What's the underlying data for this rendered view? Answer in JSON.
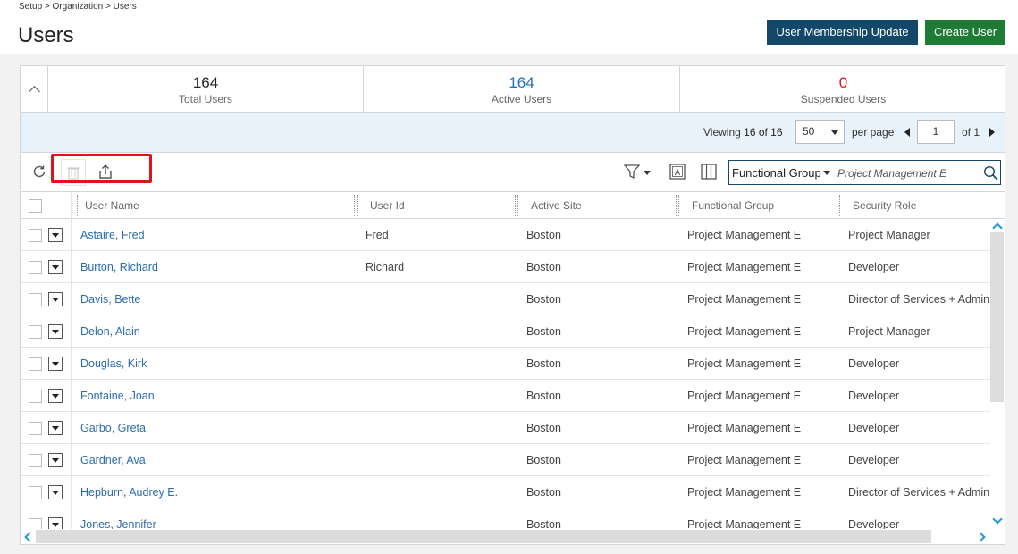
{
  "breadcrumb": "Setup > Organization > Users",
  "page_title": "Users",
  "buttons": {
    "membership_update": "User Membership Update",
    "create_user": "Create User"
  },
  "stats": [
    {
      "value": "164",
      "label": "Total Users",
      "color": "#222222"
    },
    {
      "value": "164",
      "label": "Active Users",
      "color": "#1f6fbf"
    },
    {
      "value": "0",
      "label": "Suspended Users",
      "color": "#e0121a"
    }
  ],
  "paging": {
    "viewing_label": "Viewing",
    "viewing_count": "16 of 16",
    "per_page_value": "50",
    "per_page_label": "per page",
    "page_value": "1",
    "of_label": "of 1"
  },
  "search": {
    "field": "Functional Group",
    "text": "Project Management E"
  },
  "columns": [
    "User Name",
    "User Id",
    "Active Site",
    "Functional Group",
    "Security Role"
  ],
  "rows": [
    {
      "name": "Astaire, Fred",
      "id": "Fred",
      "site": "Boston",
      "group": "Project Management E",
      "role": "Project Manager"
    },
    {
      "name": "Burton, Richard",
      "id": "Richard",
      "site": "Boston",
      "group": "Project Management E",
      "role": "Developer"
    },
    {
      "name": "Davis, Bette",
      "id": "",
      "site": "Boston",
      "group": "Project Management E",
      "role": "Director of Services + Admin"
    },
    {
      "name": "Delon, Alain",
      "id": "",
      "site": "Boston",
      "group": "Project Management E",
      "role": "Project Manager"
    },
    {
      "name": "Douglas, Kirk",
      "id": "",
      "site": "Boston",
      "group": "Project Management E",
      "role": "Developer"
    },
    {
      "name": "Fontaine, Joan",
      "id": "",
      "site": "Boston",
      "group": "Project Management E",
      "role": "Developer"
    },
    {
      "name": "Garbo, Greta",
      "id": "",
      "site": "Boston",
      "group": "Project Management E",
      "role": "Developer"
    },
    {
      "name": "Gardner, Ava",
      "id": "",
      "site": "Boston",
      "group": "Project Management E",
      "role": "Developer"
    },
    {
      "name": "Hepburn, Audrey E.",
      "id": "",
      "site": "Boston",
      "group": "Project Management E",
      "role": "Director of Services + Admin"
    },
    {
      "name": "Jones, Jennifer",
      "id": "",
      "site": "Boston",
      "group": "Project Management E",
      "role": "Developer"
    }
  ]
}
